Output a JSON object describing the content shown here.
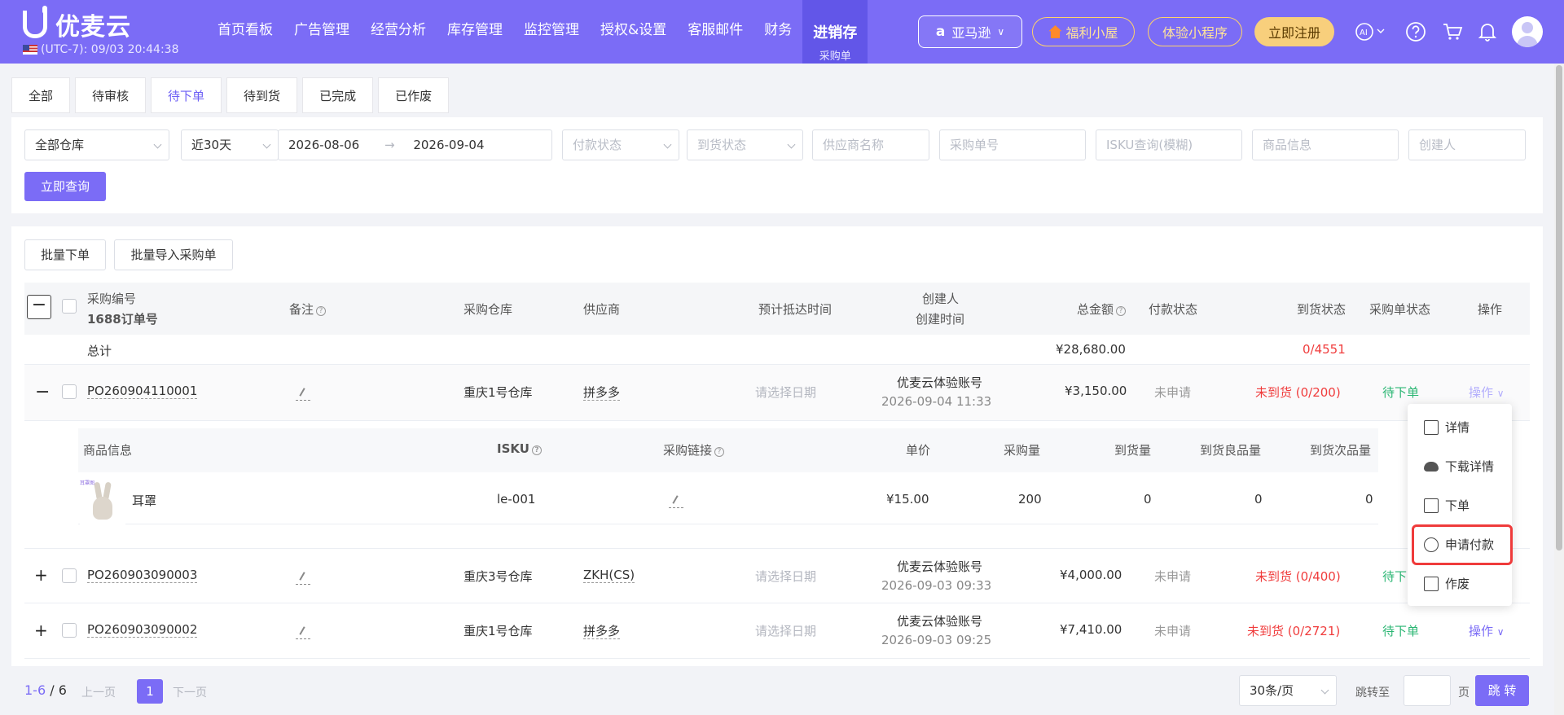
{
  "app": {
    "logo_text": "优麦云",
    "timezone": "(UTC-7): 09/03 20:44:38"
  },
  "nav": {
    "items": [
      "首页看板",
      "广告管理",
      "经营分析",
      "库存管理",
      "监控管理",
      "授权&设置",
      "客服邮件",
      "财务"
    ],
    "active": {
      "label": "进销存",
      "sub": "采购单"
    },
    "marketplace": "亚马逊",
    "welfare": "福利小屋",
    "mini_program": "体验小程序",
    "register": "立即注册"
  },
  "tabs": [
    "全部",
    "待审核",
    "待下单",
    "待到货",
    "已完成",
    "已作废"
  ],
  "active_tab": "待下单",
  "filters": {
    "warehouse": "全部仓库",
    "range": "近30天",
    "date_start": "2026-08-06",
    "date_arrow": "→",
    "date_end": "2026-09-04",
    "pay_status_ph": "付款状态",
    "arrival_status_ph": "到货状态",
    "supplier_ph": "供应商名称",
    "po_number_ph": "采购单号",
    "isku_ph": "ISKU查询(模糊)",
    "product_ph": "商品信息",
    "creator_ph": "创建人",
    "query_button": "立即查询"
  },
  "actions": {
    "batch_order": "批量下单",
    "batch_import": "批量导入采购单"
  },
  "table": {
    "headers": {
      "po_no": "采购编号",
      "order_1688": "1688订单号",
      "remark": "备注",
      "warehouse": "采购仓库",
      "supplier": "供应商",
      "eta": "预计抵达时间",
      "creator": "创建人",
      "created_at": "创建时间",
      "total": "总金额",
      "pay_status": "付款状态",
      "arrival_status": "到货状态",
      "po_status": "采购单状态",
      "operation": "操作"
    },
    "total_row": {
      "label": "总计",
      "amount": "¥28,680.00",
      "arrival": "0/4551"
    },
    "rows": [
      {
        "expand": "−",
        "po": "PO260904110001",
        "warehouse": "重庆1号仓库",
        "supplier": "拼多多",
        "eta": "请选择日期",
        "creator": "优麦云体验账号",
        "created": "2026-09-04 11:33",
        "amount": "¥3,150.00",
        "pay": "未申请",
        "arrival": "未到货 (0/200)",
        "status": "待下单",
        "op": "操作"
      },
      {
        "expand": "+",
        "po": "PO260903090003",
        "warehouse": "重庆3号仓库",
        "supplier": "ZKH(CS)",
        "eta": "请选择日期",
        "creator": "优麦云体验账号",
        "created": "2026-09-03 09:33",
        "amount": "¥4,000.00",
        "pay": "未申请",
        "arrival": "未到货 (0/400)",
        "status": "待下",
        "op": ""
      },
      {
        "expand": "+",
        "po": "PO260903090002",
        "warehouse": "重庆1号仓库",
        "supplier": "拼多多",
        "eta": "请选择日期",
        "creator": "优麦云体验账号",
        "created": "2026-09-03 09:25",
        "amount": "¥7,410.00",
        "pay": "未申请",
        "arrival": "未到货 (0/2721)",
        "status": "待下单",
        "op": "操作"
      }
    ],
    "sub_headers": {
      "product": "商品信息",
      "isku": "ISKU",
      "link": "采购链接",
      "price": "单价",
      "qty": "采购量",
      "arrived": "到货量",
      "good": "到货良品量",
      "defect": "到货次品量"
    },
    "sub_row": {
      "image_label": "耳罩图",
      "name": "耳罩",
      "isku": "le-001",
      "price": "¥15.00",
      "qty": "200",
      "arrived": "0",
      "good": "0",
      "defect": "0"
    }
  },
  "dropdown": {
    "items": [
      "详情",
      "下载详情",
      "下单",
      "申请付款",
      "作废"
    ],
    "highlighted": "申请付款"
  },
  "pagination": {
    "range": "1-6",
    "slash": "/",
    "total": "6",
    "prev": "上一页",
    "current": "1",
    "next": "下一页",
    "page_size": "30条/页",
    "goto_label": "跳转至",
    "page_unit": "页",
    "goto_button": "跳 转"
  },
  "colors": {
    "brand": "#7b6cf6",
    "danger": "#f03c3c",
    "success": "#2bb673"
  }
}
